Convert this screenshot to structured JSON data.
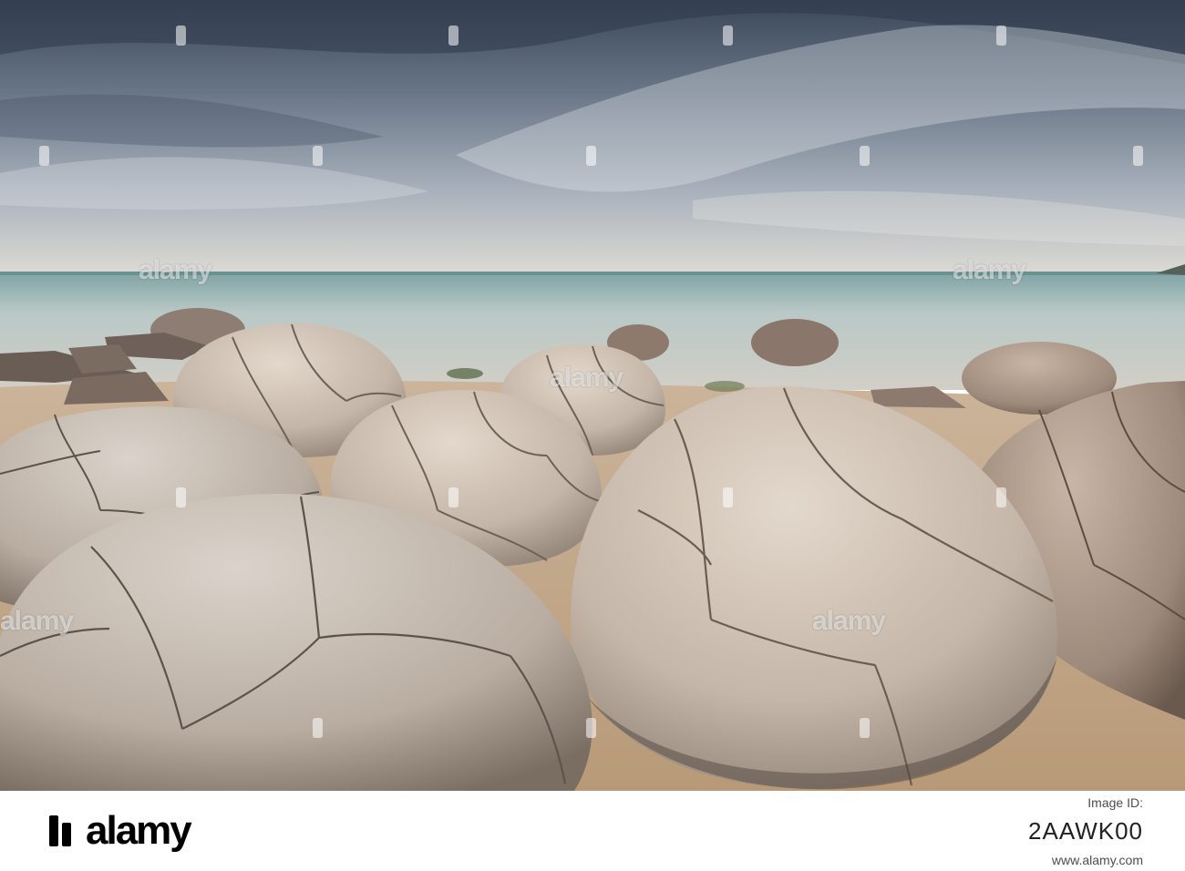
{
  "photo": {
    "description_colors": {
      "sky_dark": "#3e4d62",
      "sky_light": "#d9dde3",
      "sea": "#9fb8b6",
      "sand": "#c8ad8c",
      "boulder": "#cfc2b4",
      "boulder_shadow": "#7f7266"
    }
  },
  "watermark": {
    "text": "alamy"
  },
  "footer": {
    "logo_text": "alamy",
    "label": "Image ID:",
    "image_id": "2AAWK00",
    "url": "www.alamy.com"
  }
}
